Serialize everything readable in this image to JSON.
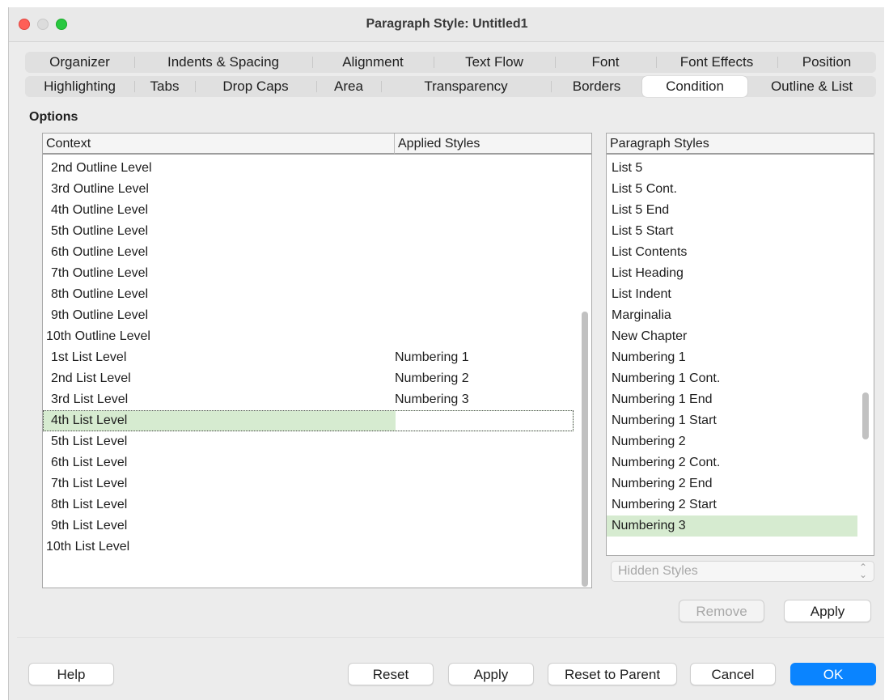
{
  "window": {
    "title": "Paragraph Style: Untitled1"
  },
  "tabs": {
    "row1": [
      "Organizer",
      "Indents & Spacing",
      "Alignment",
      "Text Flow",
      "Font",
      "Font Effects",
      "Position"
    ],
    "row2": [
      "Highlighting",
      "Tabs",
      "Drop Caps",
      "Area",
      "Transparency",
      "Borders",
      "Condition",
      "Outline & List"
    ],
    "active": "Condition"
  },
  "options": {
    "label": "Options",
    "context_table": {
      "headers": [
        "Context",
        "Applied Styles"
      ],
      "rows": [
        {
          "context": "2nd Outline Level",
          "applied": ""
        },
        {
          "context": "3rd Outline Level",
          "applied": ""
        },
        {
          "context": "4th Outline Level",
          "applied": ""
        },
        {
          "context": "5th Outline Level",
          "applied": ""
        },
        {
          "context": "6th Outline Level",
          "applied": ""
        },
        {
          "context": "7th Outline Level",
          "applied": ""
        },
        {
          "context": "8th Outline Level",
          "applied": ""
        },
        {
          "context": "9th Outline Level",
          "applied": ""
        },
        {
          "context": "10th Outline Level",
          "applied": ""
        },
        {
          "context": "1st List Level",
          "applied": "Numbering 1"
        },
        {
          "context": "2nd List Level",
          "applied": "Numbering 2"
        },
        {
          "context": "3rd List Level",
          "applied": "Numbering 3"
        },
        {
          "context": "4th List Level",
          "applied": ""
        },
        {
          "context": "5th List Level",
          "applied": ""
        },
        {
          "context": "6th List Level",
          "applied": ""
        },
        {
          "context": "7th List Level",
          "applied": ""
        },
        {
          "context": "8th List Level",
          "applied": ""
        },
        {
          "context": "9th List Level",
          "applied": ""
        },
        {
          "context": "10th List Level",
          "applied": ""
        }
      ],
      "selected": "4th List Level"
    },
    "paragraph_styles": {
      "header": "Paragraph Styles",
      "items": [
        "List 5",
        "List 5 Cont.",
        "List 5 End",
        "List 5 Start",
        "List Contents",
        "List Heading",
        "List Indent",
        "Marginalia",
        "New Chapter",
        "Numbering 1",
        "Numbering 1 Cont.",
        "Numbering 1 End",
        "Numbering 1 Start",
        "Numbering 2",
        "Numbering 2 Cont.",
        "Numbering 2 End",
        "Numbering 2 Start",
        "Numbering 3"
      ],
      "selected": "Numbering 3"
    },
    "filter_select": {
      "value": "Hidden Styles"
    },
    "remove_label": "Remove",
    "apply_label": "Apply"
  },
  "footer": {
    "help": "Help",
    "reset": "Reset",
    "apply": "Apply",
    "reset_to_parent": "Reset to Parent",
    "cancel": "Cancel",
    "ok": "OK"
  },
  "colors": {
    "selection": "#d6ebd0",
    "primary_button": "#0a84ff",
    "close": "#fe5f57",
    "maximize": "#28c840"
  },
  "icons": {
    "select_arrows": "up-down-chevron-icon"
  }
}
